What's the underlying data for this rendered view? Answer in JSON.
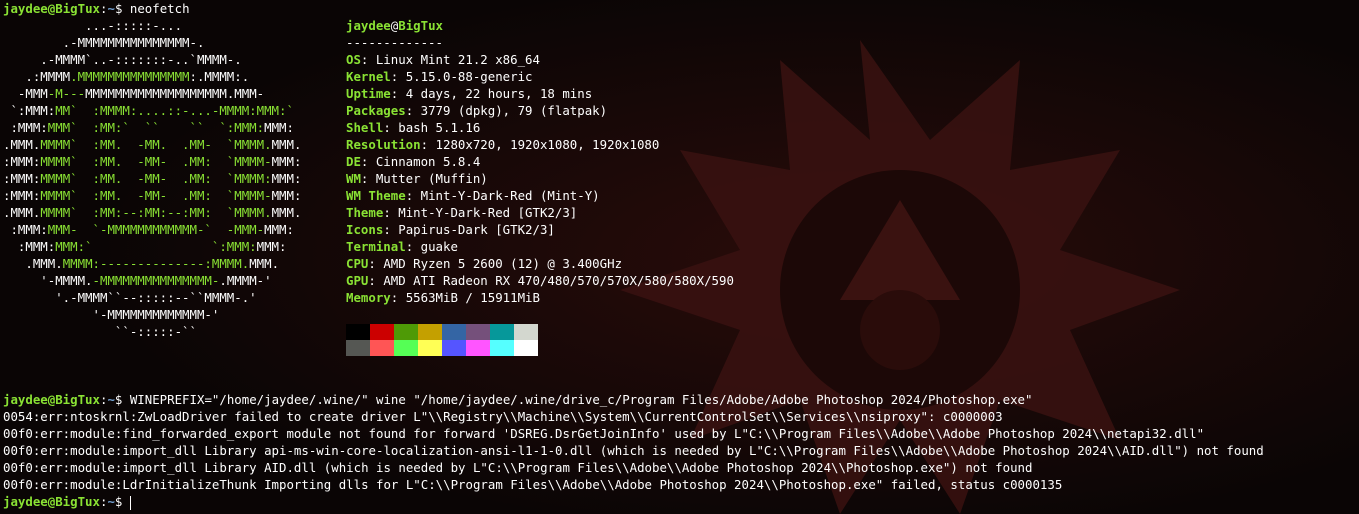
{
  "prompt": {
    "user": "jaydee",
    "host": "BigTux",
    "path": "~"
  },
  "first_command": "neofetch",
  "logo_lines": [
    [
      [
        "           ...-:::::-...",
        "w"
      ]
    ],
    [
      [
        "        .-MMMMMMMMMMMMMMM-.",
        "w"
      ]
    ],
    [
      [
        "     .-MMMM`..-:::::::-..`MMMM-.",
        "w"
      ]
    ],
    [
      [
        "   .:MMMM",
        "w"
      ],
      [
        ".MMMMMMMMMMMMMMM",
        "g"
      ],
      [
        ":.MMMM:.",
        "w"
      ]
    ],
    [
      [
        "  -MMM",
        "w"
      ],
      [
        "-M---",
        "g"
      ],
      [
        "MMMMMMMMMMMMMMMMMMM.MMM-",
        "w"
      ]
    ],
    [
      [
        " `:MMM:",
        "w"
      ],
      [
        "MM`  :MMMM:....::-...-MMMM:MMM:`",
        "g"
      ]
    ],
    [
      [
        " :MMM:",
        "w"
      ],
      [
        "MMM`  :MM:`  ``    ``  `:MMM:",
        "g"
      ],
      [
        "MMM:",
        "w"
      ]
    ],
    [
      [
        ".MMM.",
        "w"
      ],
      [
        "MMMM`  :MM.  -MM.  .MM-  `MMMM.",
        "g"
      ],
      [
        "MMM.",
        "w"
      ]
    ],
    [
      [
        ":MMM:",
        "w"
      ],
      [
        "MMMM`  :MM.  -MM-  .MM:  `MMMM-",
        "g"
      ],
      [
        "MMM:",
        "w"
      ]
    ],
    [
      [
        ":MMM:",
        "w"
      ],
      [
        "MMMM`  :MM.  -MM-  .MM:  `MMMM:",
        "g"
      ],
      [
        "MMM:",
        "w"
      ]
    ],
    [
      [
        ":MMM:",
        "w"
      ],
      [
        "MMMM`  :MM.  -MM-  .MM:  `MMMM-",
        "g"
      ],
      [
        "MMM:",
        "w"
      ]
    ],
    [
      [
        ".MMM.",
        "w"
      ],
      [
        "MMMM`  :MM:--:MM:--:MM:  `MMMM.",
        "g"
      ],
      [
        "MMM.",
        "w"
      ]
    ],
    [
      [
        " :MMM:",
        "w"
      ],
      [
        "MMM-  `-MMMMMMMMMMMM-`  -MMM-",
        "g"
      ],
      [
        "MMM:",
        "w"
      ]
    ],
    [
      [
        "  :MMM:",
        "w"
      ],
      [
        "MMM:`                `:MMM:",
        "g"
      ],
      [
        "MMM:",
        "w"
      ]
    ],
    [
      [
        "   .MMM.",
        "w"
      ],
      [
        "MMMM:--------------:MMMM.",
        "g"
      ],
      [
        "MMM.",
        "w"
      ]
    ],
    [
      [
        "     '-MMMM.",
        "w"
      ],
      [
        "-MMMMMMMMMMMMMMM-",
        "g"
      ],
      [
        ".MMMM-'",
        "w"
      ]
    ],
    [
      [
        "       '.-MMMM``--:::::--``MMMM-.'",
        "w"
      ]
    ],
    [
      [
        "            '-MMMMMMMMMMMMM-'",
        "w"
      ]
    ],
    [
      [
        "               ``-:::::-``",
        "w"
      ]
    ]
  ],
  "info": {
    "title_user": "jaydee",
    "title_host": "BigTux",
    "separator": "-------------",
    "rows": [
      {
        "key": "OS",
        "value": "Linux Mint 21.2 x86_64"
      },
      {
        "key": "Kernel",
        "value": "5.15.0-88-generic"
      },
      {
        "key": "Uptime",
        "value": "4 days, 22 hours, 18 mins"
      },
      {
        "key": "Packages",
        "value": "3779 (dpkg), 79 (flatpak)"
      },
      {
        "key": "Shell",
        "value": "bash 5.1.16"
      },
      {
        "key": "Resolution",
        "value": "1280x720, 1920x1080, 1920x1080"
      },
      {
        "key": "DE",
        "value": "Cinnamon 5.8.4"
      },
      {
        "key": "WM",
        "value": "Mutter (Muffin)"
      },
      {
        "key": "WM Theme",
        "value": "Mint-Y-Dark-Red (Mint-Y)"
      },
      {
        "key": "Theme",
        "value": "Mint-Y-Dark-Red [GTK2/3]"
      },
      {
        "key": "Icons",
        "value": "Papirus-Dark [GTK2/3]"
      },
      {
        "key": "Terminal",
        "value": "guake"
      },
      {
        "key": "CPU",
        "value": "AMD Ryzen 5 2600 (12) @ 3.400GHz"
      },
      {
        "key": "GPU",
        "value": "AMD ATI Radeon RX 470/480/570/570X/580/580X/590"
      },
      {
        "key": "Memory",
        "value": "5563MiB / 15911MiB"
      }
    ]
  },
  "palette": {
    "top": [
      "#000000",
      "#cc0000",
      "#4e9a06",
      "#c4a000",
      "#3465a4",
      "#75507b",
      "#06989a",
      "#d3d7cf"
    ],
    "bottom": [
      "#555753",
      "#ff5555",
      "#55ff55",
      "#ffff55",
      "#5555ff",
      "#ff55ff",
      "#55ffff",
      "#ffffff"
    ]
  },
  "second_command": "WINEPREFIX=\"/home/jaydee/.wine/\" wine \"/home/jaydee/.wine/drive_c/Program Files/Adobe/Adobe Photoshop 2024/Photoshop.exe\"",
  "output_lines": [
    "0054:err:ntoskrnl:ZwLoadDriver failed to create driver L\"\\\\Registry\\\\Machine\\\\System\\\\CurrentControlSet\\\\Services\\\\nsiproxy\": c0000003",
    "00f0:err:module:find_forwarded_export module not found for forward 'DSREG.DsrGetJoinInfo' used by L\"C:\\\\Program Files\\\\Adobe\\\\Adobe Photoshop 2024\\\\netapi32.dll\"",
    "00f0:err:module:import_dll Library api-ms-win-core-localization-ansi-l1-1-0.dll (which is needed by L\"C:\\\\Program Files\\\\Adobe\\\\Adobe Photoshop 2024\\\\AID.dll\") not found",
    "00f0:err:module:import_dll Library AID.dll (which is needed by L\"C:\\\\Program Files\\\\Adobe\\\\Adobe Photoshop 2024\\\\Photoshop.exe\") not found",
    "00f0:err:module:LdrInitializeThunk Importing dlls for L\"C:\\\\Program Files\\\\Adobe\\\\Adobe Photoshop 2024\\\\Photoshop.exe\" failed, status c0000135"
  ]
}
